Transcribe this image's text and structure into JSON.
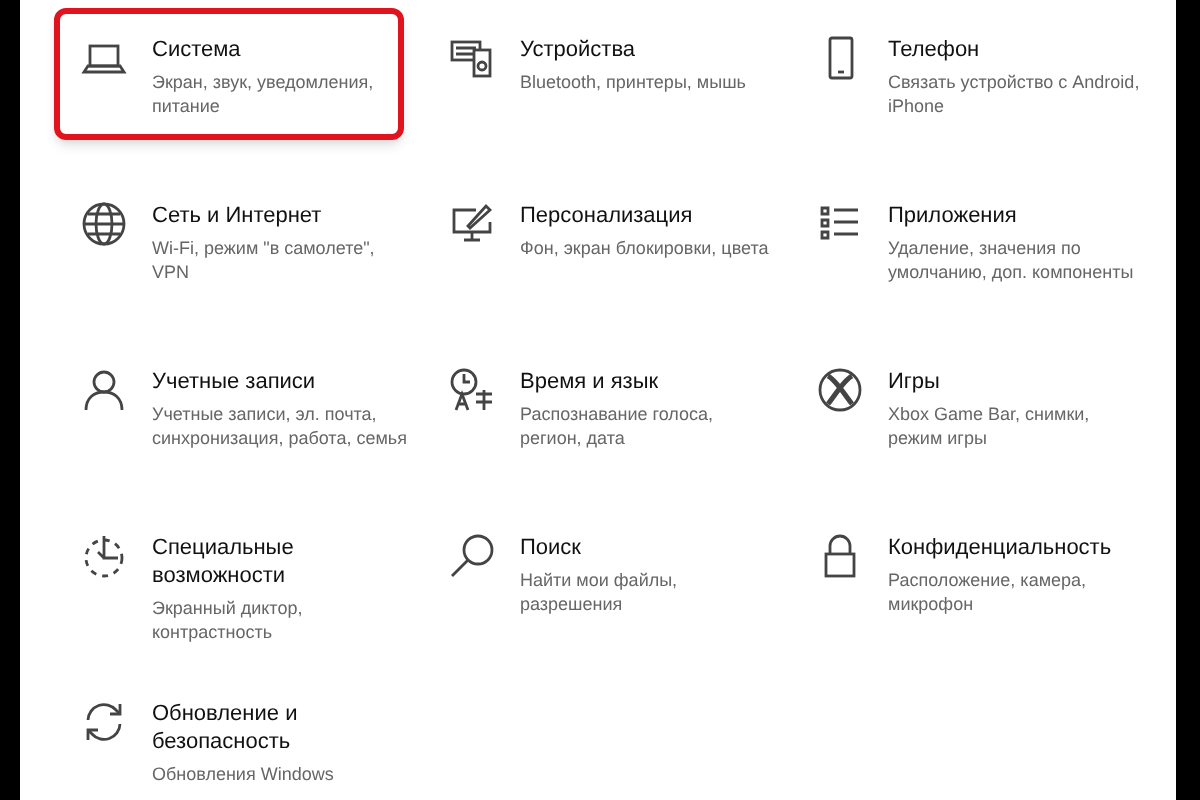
{
  "categories": [
    {
      "title": [
        "Система"
      ],
      "description": [
        "Экран, звук, уведомления,",
        "питание"
      ],
      "highlighted": true
    },
    {
      "title": [
        "Устройства"
      ],
      "description": [
        "Bluetooth, принтеры, мышь"
      ],
      "highlighted": false
    },
    {
      "title": [
        "Телефон"
      ],
      "description": [
        "Связать устройство с Android,",
        "iPhone"
      ],
      "highlighted": false
    },
    {
      "title": [
        "Сеть и Интернет"
      ],
      "description": [
        "Wi-Fi, режим \"в самолете\",",
        "VPN"
      ],
      "highlighted": false
    },
    {
      "title": [
        "Персонализация"
      ],
      "description": [
        "Фон, экран блокировки, цвета"
      ],
      "highlighted": false
    },
    {
      "title": [
        "Приложения"
      ],
      "description": [
        "Удаление, значения по",
        "умолчанию, доп. компоненты"
      ],
      "highlighted": false
    },
    {
      "title": [
        "Учетные записи"
      ],
      "description": [
        "Учетные записи, эл. почта,",
        "синхронизация, работа, семья"
      ],
      "highlighted": false
    },
    {
      "title": [
        "Время и язык"
      ],
      "description": [
        "Распознавание голоса,",
        "регион, дата"
      ],
      "highlighted": false
    },
    {
      "title": [
        "Игры"
      ],
      "description": [
        "Xbox Game Bar, снимки,",
        "режим игры"
      ],
      "highlighted": false
    },
    {
      "title": [
        "Специальные",
        "возможности"
      ],
      "description": [
        "Экранный диктор,",
        "контрастность"
      ],
      "highlighted": false
    },
    {
      "title": [
        "Поиск"
      ],
      "description": [
        "Найти мои файлы,",
        "разрешения"
      ],
      "highlighted": false
    },
    {
      "title": [
        "Конфиденциальность"
      ],
      "description": [
        "Расположение, камера,",
        "микрофон"
      ],
      "highlighted": false
    },
    {
      "title": [
        "Обновление и",
        "безопасность"
      ],
      "description": [
        "Обновления Windows"
      ],
      "highlighted": false
    }
  ]
}
